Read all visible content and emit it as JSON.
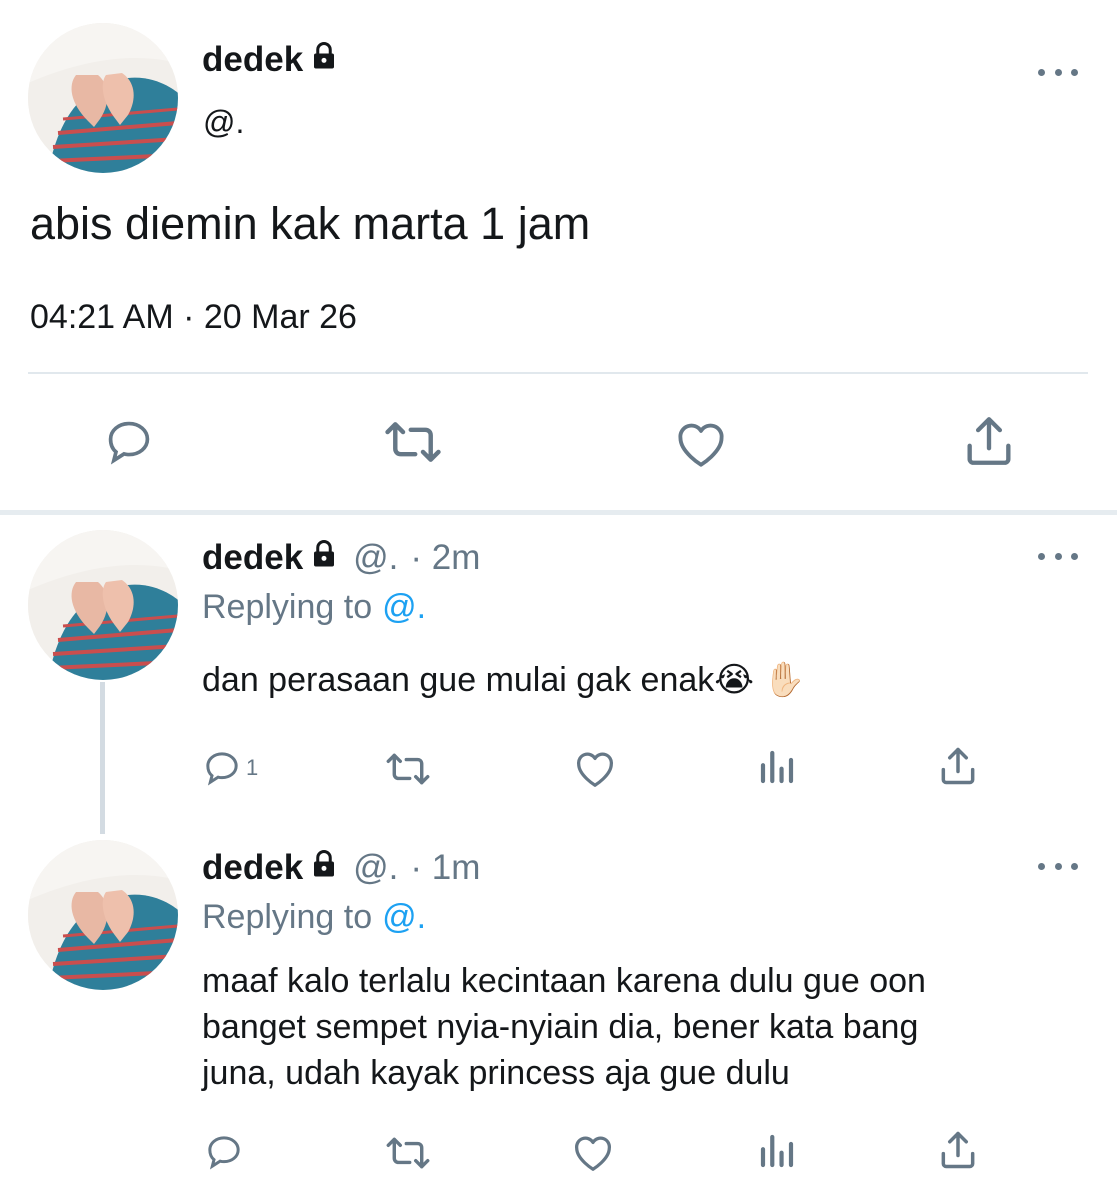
{
  "main_tweet": {
    "name": "dedek",
    "handle": "@.",
    "text": "abis diemin kak marta 1 jam",
    "timestamp": "04:21 AM · 20 Mar 26",
    "icons": [
      "lock-icon",
      "more-icon",
      "reply-icon",
      "retweet-icon",
      "like-icon",
      "share-icon"
    ]
  },
  "replies": [
    {
      "name": "dedek",
      "handle": "@.",
      "time": "· 2m",
      "replying_label": "Replying to",
      "replying_handle": "@.",
      "text": "dan perasaan gue mulai gak enak😭 ✋🏻",
      "reply_count": "1",
      "icons": [
        "reply-icon",
        "retweet-icon",
        "like-icon",
        "analytics-icon",
        "share-icon"
      ]
    },
    {
      "name": "dedek",
      "handle": "@.",
      "time": "· 1m",
      "replying_label": "Replying to",
      "replying_handle": "@.",
      "text_lines": [
        "maaf kalo terlalu kecintaan karena dulu gue oon",
        "banget sempet nyia-nyiain dia, bener kata bang",
        "juna, udah kayak princess aja gue dulu"
      ],
      "icons": [
        "reply-icon",
        "retweet-icon",
        "like-icon",
        "analytics-icon",
        "share-icon"
      ]
    }
  ],
  "colors": {
    "text": "#14171a",
    "muted": "#657786",
    "link": "#1da1f2",
    "divider": "#e1e8ed"
  }
}
